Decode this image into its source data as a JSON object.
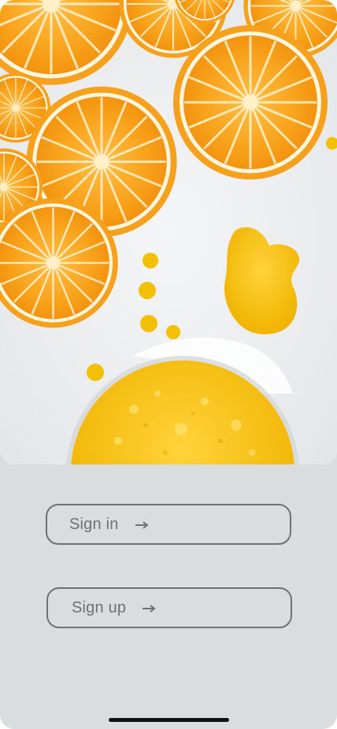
{
  "hero": {
    "image": "orange-slices-and-juice-photo"
  },
  "auth": {
    "sign_in_label": "Sign in",
    "sign_up_label": "Sign up",
    "arrow_icon": "arrow-right-icon"
  },
  "colors": {
    "background": "#d9dde0",
    "button_border": "#6f7275",
    "orange": "#f7a21a",
    "juice": "#f2c000"
  }
}
